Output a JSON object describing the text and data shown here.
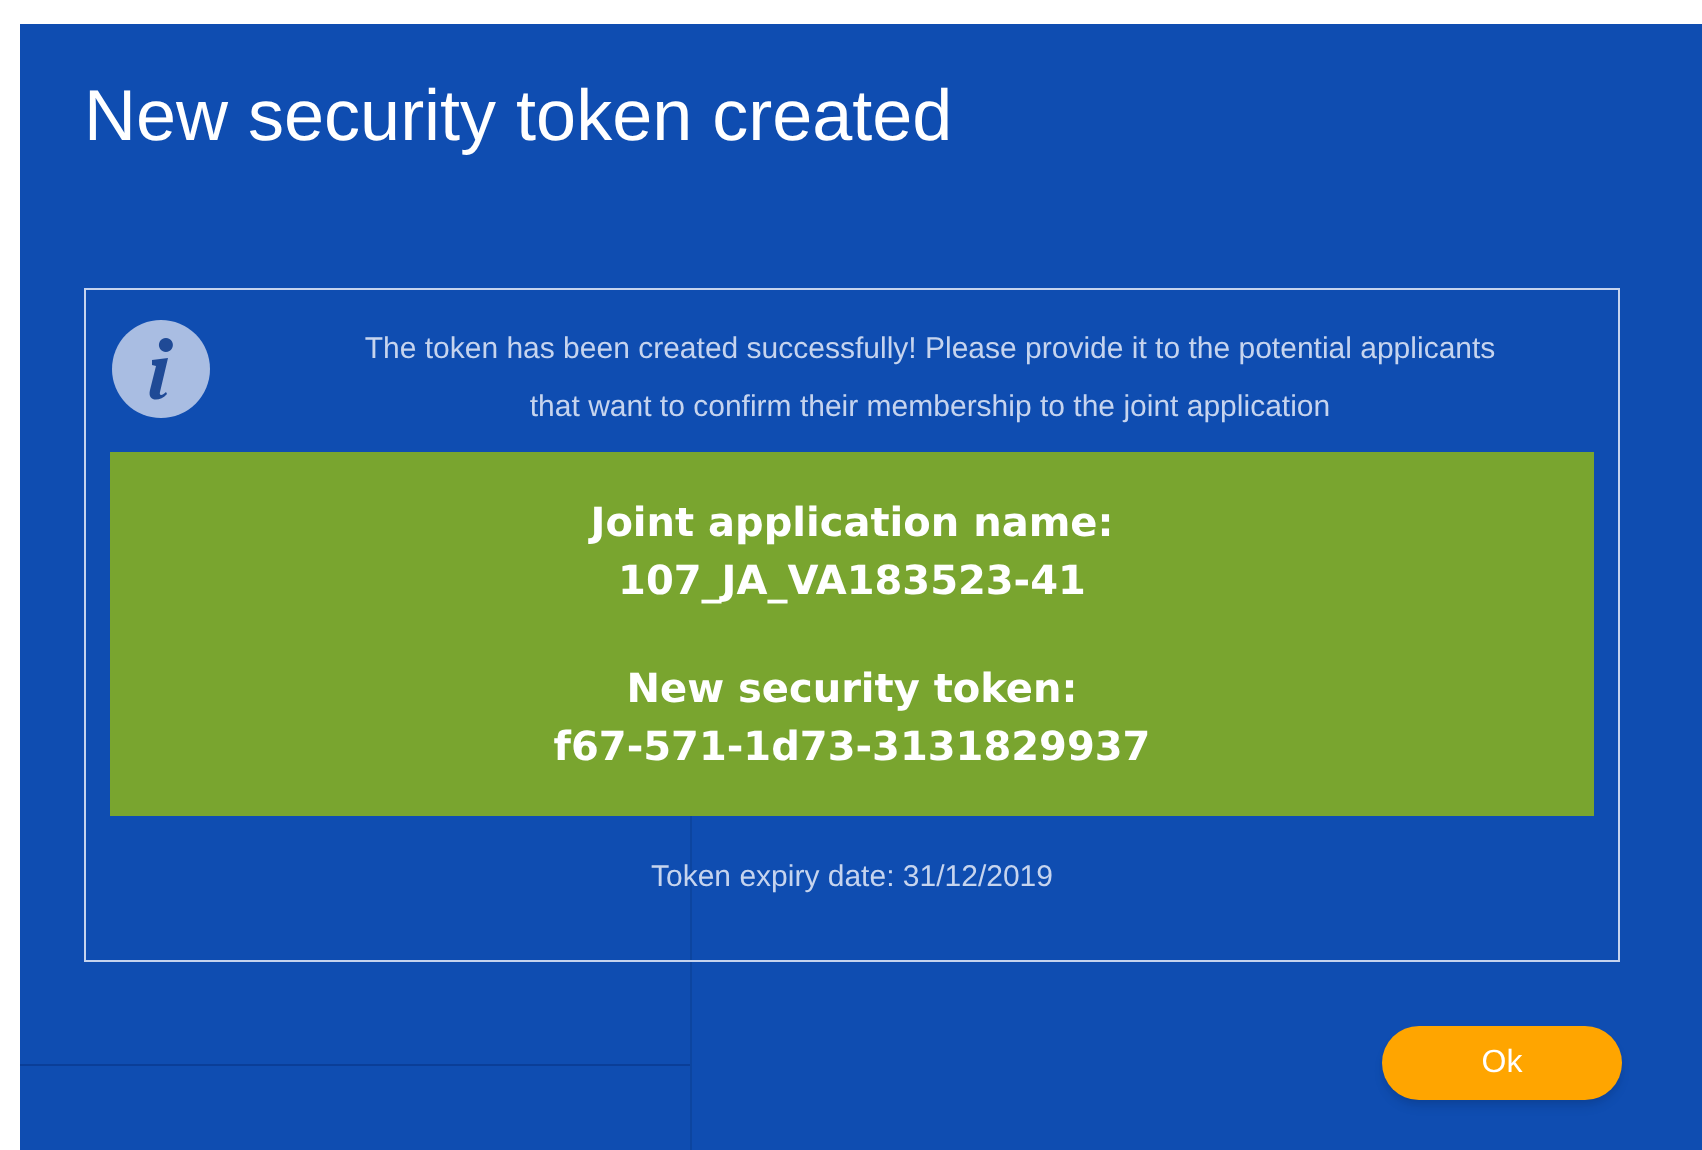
{
  "dialog": {
    "title": "New security token created",
    "message": "The token has been created successfully! Please provide it to the potential applicants that want to confirm their membership to the joint application",
    "joint_application_label": "Joint application name:",
    "joint_application_name": "107_JA_VA183523-41",
    "token_label": "New security token:",
    "token": "f67-571-1d73-3131829937",
    "expiry": "Token expiry date: 31/12/2019",
    "ok_button": "Ok"
  }
}
